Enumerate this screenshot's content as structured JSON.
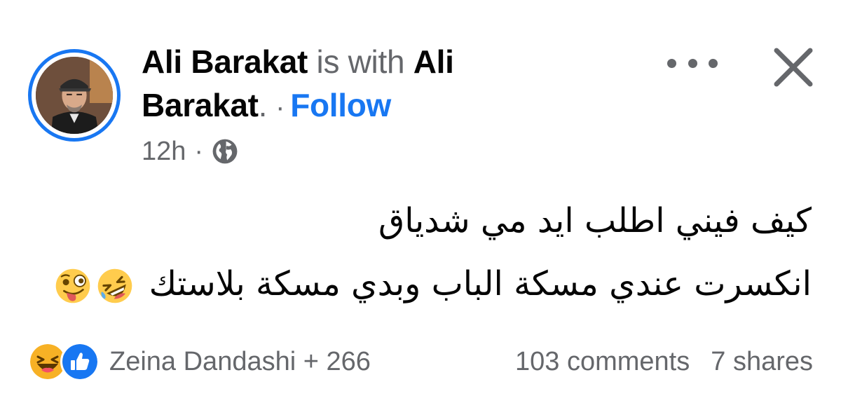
{
  "header": {
    "author": "Ali Barakat",
    "with_text": "is with",
    "tagged_first": "Ali",
    "tagged_second": "Barakat",
    "period": ".",
    "separator": "·",
    "follow_label": "Follow"
  },
  "meta": {
    "time": "12h",
    "separator": "·",
    "audience_icon": "globe-icon"
  },
  "post": {
    "line1": "كيف فيني اطلب ايد مي شدياق",
    "line2": "انكسرت عندي مسكة الباب وبدي مسكة بلاستك",
    "emojis": [
      "rolling-on-floor-laughing",
      "zany-face"
    ]
  },
  "footer": {
    "reactions": [
      "haha",
      "like"
    ],
    "reactors": "Zeina Dandashi + 266",
    "comments": "103 comments",
    "shares": "7 shares"
  },
  "colors": {
    "accent": "#1877f2",
    "muted": "#65676b",
    "text": "#050505"
  }
}
